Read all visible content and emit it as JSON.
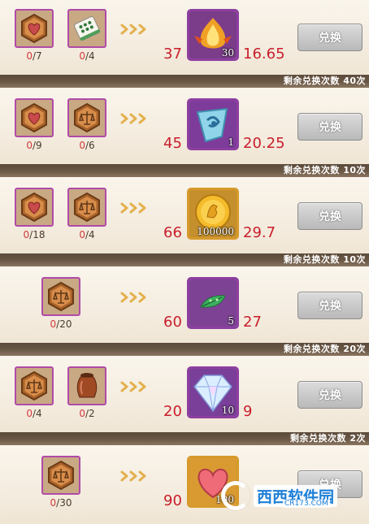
{
  "button_label": "兑换",
  "rows": [
    {
      "remain": "剩余兑换次数 10次",
      "costs": [
        {
          "icon": "heart-token-icon",
          "have": "0",
          "need": "7"
        },
        {
          "icon": "mahjong-tile-icon",
          "have": "0",
          "need": "4"
        }
      ],
      "reward": {
        "icon": "flame-bulb-icon",
        "qty": "30",
        "frame": "purple"
      },
      "left_num": "37",
      "right_num": "16.65"
    },
    {
      "remain": "剩余兑换次数 40次",
      "costs": [
        {
          "icon": "heart-token-icon",
          "have": "0",
          "need": "9"
        },
        {
          "icon": "scales-token-icon",
          "have": "0",
          "need": "6"
        }
      ],
      "reward": {
        "icon": "blue-crystal-icon",
        "qty": "1",
        "frame": "purple"
      },
      "left_num": "45",
      "right_num": "20.25"
    },
    {
      "remain": "剩余兑换次数 10次",
      "costs": [
        {
          "icon": "heart-token-icon",
          "have": "0",
          "need": "18"
        },
        {
          "icon": "scales-token-icon",
          "have": "0",
          "need": "4"
        }
      ],
      "reward": {
        "icon": "gold-coin-icon",
        "qty": "100000",
        "frame": "gold"
      },
      "left_num": "66",
      "right_num": "29.7"
    },
    {
      "remain": "剩余兑换次数 10次",
      "costs": [
        {
          "icon": "scales-token-icon",
          "have": "0",
          "need": "20"
        }
      ],
      "reward": {
        "icon": "green-leaf-icon",
        "qty": "5",
        "frame": "purple"
      },
      "left_num": "60",
      "right_num": "27"
    },
    {
      "remain": "剩余兑换次数 20次",
      "costs": [
        {
          "icon": "scales-token-icon",
          "have": "0",
          "need": "4"
        },
        {
          "icon": "clay-jar-icon",
          "have": "0",
          "need": "2"
        }
      ],
      "reward": {
        "icon": "diamond-gem-icon",
        "qty": "10",
        "frame": "purple"
      },
      "left_num": "20",
      "right_num": "9"
    },
    {
      "remain": "剩余兑换次数 2次",
      "costs": [
        {
          "icon": "scales-token-icon",
          "have": "0",
          "need": "30"
        }
      ],
      "reward": {
        "icon": "pink-heart-icon",
        "qty": "100",
        "frame": "gold"
      },
      "left_num": "90",
      "right_num": ""
    }
  ],
  "watermark": {
    "brand": "西西软件园",
    "site": "CR173.COM"
  }
}
